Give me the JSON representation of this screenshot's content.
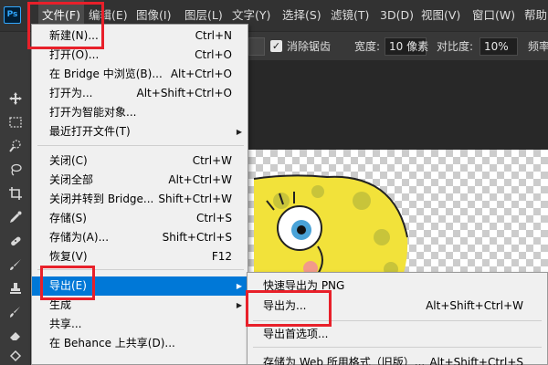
{
  "app": {
    "logo": "Ps"
  },
  "menubar": {
    "items": [
      "文件(F)",
      "编辑(E)",
      "图像(I)",
      "图层(L)",
      "文字(Y)",
      "选择(S)",
      "滤镜(T)",
      "3D(D)",
      "视图(V)",
      "窗口(W)",
      "帮助"
    ]
  },
  "options": {
    "antialias_label": "消除锯齿",
    "width_label": "宽度:",
    "width_value": "10 像素",
    "contrast_label": "对比度:",
    "contrast_value": "10%",
    "frequency_label": "频率"
  },
  "file_menu": {
    "items": [
      {
        "label": "新建(N)...",
        "shortcut": "Ctrl+N"
      },
      {
        "label": "打开(O)...",
        "shortcut": "Ctrl+O"
      },
      {
        "label": "在 Bridge 中浏览(B)...",
        "shortcut": "Alt+Ctrl+O"
      },
      {
        "label": "打开为...",
        "shortcut": "Alt+Shift+Ctrl+O"
      },
      {
        "label": "打开为智能对象...",
        "shortcut": ""
      },
      {
        "label": "最近打开文件(T)",
        "shortcut": ""
      },
      {
        "label": "关闭(C)",
        "shortcut": "Ctrl+W"
      },
      {
        "label": "关闭全部",
        "shortcut": "Alt+Ctrl+W"
      },
      {
        "label": "关闭并转到 Bridge...",
        "shortcut": "Shift+Ctrl+W"
      },
      {
        "label": "存储(S)",
        "shortcut": "Ctrl+S"
      },
      {
        "label": "存储为(A)...",
        "shortcut": "Shift+Ctrl+S"
      },
      {
        "label": "恢复(V)",
        "shortcut": "F12"
      },
      {
        "label": "导出(E)",
        "shortcut": ""
      },
      {
        "label": "生成",
        "shortcut": ""
      },
      {
        "label": "共享...",
        "shortcut": ""
      },
      {
        "label": "在 Behance 上共享(D)...",
        "shortcut": ""
      }
    ]
  },
  "export_submenu": {
    "items": [
      {
        "label": "快速导出为 PNG",
        "shortcut": ""
      },
      {
        "label": "导出为...",
        "shortcut": "Alt+Shift+Ctrl+W"
      },
      {
        "label": "导出首选项...",
        "shortcut": ""
      },
      {
        "label": "存储为 Web 所用格式（旧版）...",
        "shortcut": "Alt+Shift+Ctrl+S"
      }
    ]
  },
  "icons": {
    "toolbar": [
      "move-icon",
      "marquee-icon",
      "quick-select-icon",
      "lasso-icon",
      "crop-icon",
      "eyedropper-icon",
      "healing-brush-icon",
      "brush-icon",
      "clone-stamp-icon",
      "history-brush-icon",
      "eraser-icon",
      "paint-bucket-icon"
    ]
  },
  "colors": {
    "highlight": "#0078d7",
    "annotation": "#e8202a",
    "menubar_bg": "#323232"
  }
}
